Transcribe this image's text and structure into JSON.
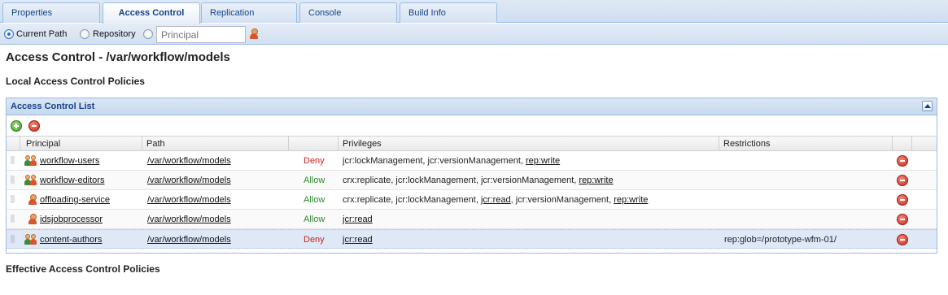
{
  "tabs": [
    {
      "label": "Properties"
    },
    {
      "label": "Access Control"
    },
    {
      "label": "Replication"
    },
    {
      "label": "Console"
    },
    {
      "label": "Build Info"
    }
  ],
  "scope": {
    "current_path": "Current Path",
    "repository": "Repository",
    "principal_placeholder": "Principal"
  },
  "page": {
    "title": "Access Control - /var/workflow/models",
    "local_heading": "Local Access Control Policies",
    "effective_heading": "Effective Access Control Policies"
  },
  "acl": {
    "panel_title": "Access Control List",
    "columns": [
      "Principal",
      "Path",
      "",
      "Privileges",
      "Restrictions"
    ],
    "rows": [
      {
        "principal": "workflow-users",
        "principal_type": "group-icon",
        "path": "/var/workflow/models",
        "effect": "Deny",
        "privileges": [
          {
            "t": "jcr:lockManagement, jcr:versionManagement, ",
            "u": false
          },
          {
            "t": "rep:write",
            "u": true
          }
        ],
        "restrictions": ""
      },
      {
        "principal": "workflow-editors",
        "principal_type": "group-icon",
        "path": "/var/workflow/models",
        "effect": "Allow",
        "privileges": [
          {
            "t": "crx:replicate, jcr:lockManagement, jcr:versionManagement, ",
            "u": false
          },
          {
            "t": "rep:write",
            "u": true
          }
        ],
        "restrictions": ""
      },
      {
        "principal": "offloading-service",
        "principal_type": "user-icon",
        "path": "/var/workflow/models",
        "effect": "Allow",
        "privileges": [
          {
            "t": "crx:replicate, jcr:lockManagement, ",
            "u": false
          },
          {
            "t": "jcr:read",
            "u": true
          },
          {
            "t": ", jcr:versionManagement, ",
            "u": false
          },
          {
            "t": "rep:write",
            "u": true
          }
        ],
        "restrictions": ""
      },
      {
        "principal": "idsjobprocessor",
        "principal_type": "user-icon",
        "path": "/var/workflow/models",
        "effect": "Allow",
        "privileges": [
          {
            "t": "jcr:read",
            "u": true
          }
        ],
        "restrictions": ""
      },
      {
        "principal": "content-authors",
        "principal_type": "group-icon",
        "path": "/var/workflow/models",
        "effect": "Deny",
        "privileges": [
          {
            "t": "jcr:read",
            "u": true
          }
        ],
        "restrictions": "rep:glob=/prototype-wfm-01/"
      }
    ]
  }
}
